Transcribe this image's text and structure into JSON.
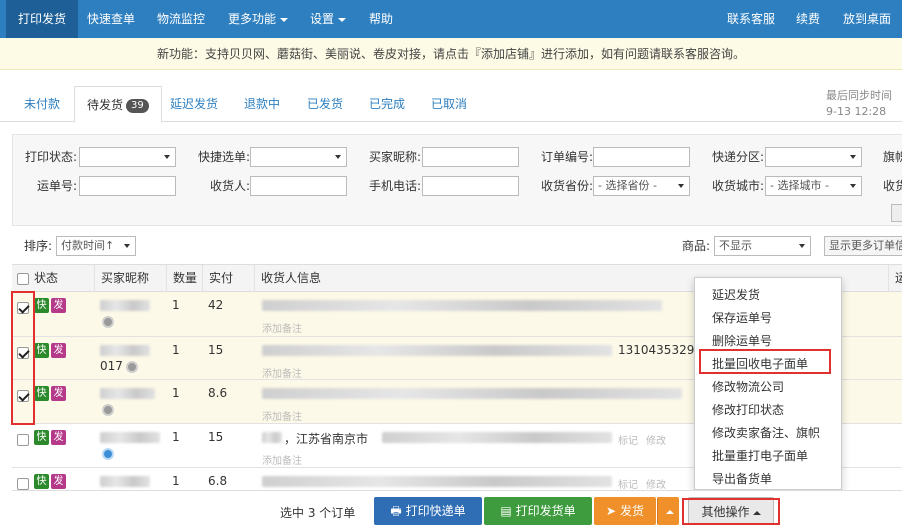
{
  "nav": {
    "items": [
      "打印发货",
      "快速查单",
      "物流监控",
      "更多功能",
      "设置",
      "帮助"
    ],
    "right": [
      "联系客服",
      "续费",
      "放到桌面"
    ]
  },
  "notice": "新功能：支持贝贝网、蘑菇街、美丽说、卷皮对接，请点击『添加店铺』进行添加，如有问题请联系客服咨询。",
  "tabs": {
    "items": [
      "未付款",
      "待发货",
      "延迟发货",
      "退款中",
      "已发货",
      "已完成",
      "已取消"
    ],
    "badge": "39"
  },
  "sync": {
    "label": "最后同步时间",
    "time": "9-13 12:28"
  },
  "filters": {
    "print_status": "打印状态:",
    "quick_select": "快捷选单:",
    "buyer_nick": "买家昵称:",
    "order_no": "订单编号:",
    "express_zone": "快递分区:",
    "flag": "旗帜",
    "waybill_no": "运单号:",
    "receiver": "收货人:",
    "phone": "手机电话:",
    "province": "收货省份:",
    "province_placeholder": "- 选择省份 -",
    "city": "收货城市:",
    "city_placeholder": "- 选择城市 -",
    "more": "收货"
  },
  "sortbar": {
    "sort_label": "排序:",
    "sort_value": "付款时间↑",
    "goods_label": "商品:",
    "goods_value": "不显示",
    "more_btn": "显示更多订单信"
  },
  "table": {
    "headers": [
      "状态",
      "买家昵称",
      "数量",
      "实付",
      "收货人信息",
      "运"
    ],
    "rows": [
      {
        "qty": "1",
        "paid": "42",
        "addr_tail": "",
        "checked": true
      },
      {
        "qty": "1",
        "paid": "15",
        "nick_tail": "017",
        "addr_tail": "13104353292",
        "checked": true
      },
      {
        "qty": "1",
        "paid": "8.6",
        "addr_tail": "",
        "checked": true
      },
      {
        "qty": "1",
        "paid": "15",
        "addr_text": "，江苏省南京市",
        "checked": false
      },
      {
        "qty": "1",
        "paid": "6.8",
        "checked": false
      }
    ],
    "tag_kuai": "快",
    "tag_fa": "发",
    "add_note": "添加备注",
    "link_mark": "标记",
    "link_edit": "修改"
  },
  "dropdown": [
    "延迟发货",
    "保存运单号",
    "删除运单号",
    "批量回收电子面单",
    "修改物流公司",
    "修改打印状态",
    "修改卖家备注、旗帜",
    "批量重打电子面单",
    "导出备货单"
  ],
  "bottom": {
    "selected": "选中 3 个订单",
    "print_express": "打印快递单",
    "print_invoice": "打印发货单",
    "ship": "发货",
    "other": "其他操作"
  }
}
